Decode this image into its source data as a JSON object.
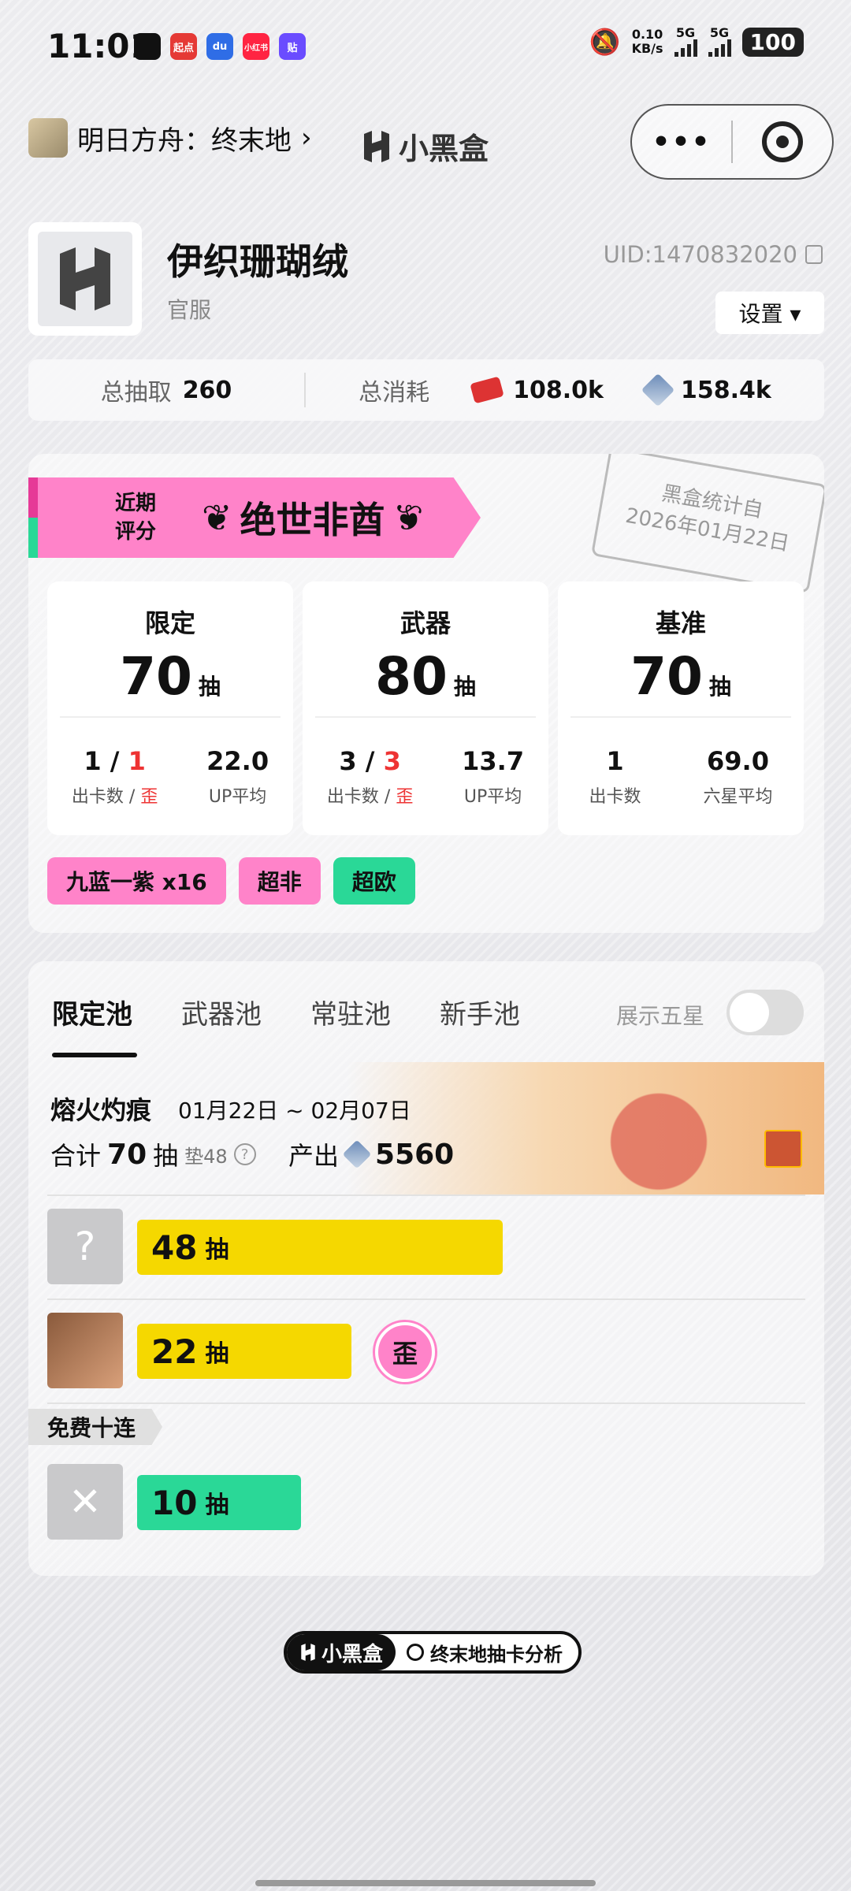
{
  "status": {
    "time": "11:01",
    "apps": [
      {
        "text": "",
        "color": "#111111"
      },
      {
        "text": "起点",
        "color": "#e53935"
      },
      {
        "text": "du",
        "color": "#2f6de6"
      },
      {
        "text": "小红书",
        "color": "#ff2442"
      },
      {
        "text": "贴",
        "color": "#6a4cff"
      }
    ],
    "net_speed": "0.10",
    "net_unit": "KB/s",
    "net_tag1": "5G",
    "net_tag2": "5G",
    "battery": "100"
  },
  "nav": {
    "game_title": "明日方舟：终末地",
    "chevron": "›",
    "brand": "小黑盒",
    "menu_dots": "•••"
  },
  "profile": {
    "name": "伊织珊瑚绒",
    "server": "官服",
    "uid": "UID:1470832020",
    "settings_label": "设置 ▾"
  },
  "totals": {
    "pulls_label": "总抽取",
    "pulls_value": "260",
    "spend_label": "总消耗",
    "ticket_value": "108.0k",
    "orundum_value": "158.4k"
  },
  "summary": {
    "rating_label": "近期\n评分",
    "rating_value": "绝世非酋",
    "laurel_left": "❦",
    "laurel_right": "❦",
    "stamp_line1": "黑盒统计自",
    "stamp_line2": "2026年01月22日",
    "pull_unit": "抽",
    "boxes": [
      {
        "title": "限定",
        "count": "70",
        "a": "1",
        "b": "1",
        "avg": "22.0",
        "a_label": "出卡数",
        "b_label": "歪",
        "avg_label": "UP平均"
      },
      {
        "title": "武器",
        "count": "80",
        "a": "3",
        "b": "3",
        "avg": "13.7",
        "a_label": "出卡数",
        "b_label": "歪",
        "avg_label": "UP平均"
      },
      {
        "title": "基准",
        "count": "70",
        "a": "1",
        "avg": "69.0",
        "a_label": "出卡数",
        "avg_label": "六星平均"
      }
    ],
    "tags": [
      {
        "label": "九蓝一紫 x16",
        "color": "#ff83c9"
      },
      {
        "label": "超非",
        "color": "#ff83c9"
      },
      {
        "label": "超欧",
        "color": "#2ad897"
      }
    ]
  },
  "pool": {
    "tabs": [
      "限定池",
      "武器池",
      "常驻池",
      "新手池"
    ],
    "toggle_label": "展示五星",
    "name": "熔火灼痕",
    "date": "01月22日 ~ 02月07日",
    "total_label": "合计",
    "total_value": "70",
    "total_unit": "抽",
    "pity": "垫48",
    "help": "?",
    "output_label": "产出",
    "output_value": "5560",
    "rows": [
      {
        "count": "48",
        "unit": "抽",
        "avatar": "?",
        "fraction": 0.58,
        "color": "#f5d800",
        "avatar_bg": "#c9c9cb"
      },
      {
        "count": "22",
        "unit": "抽",
        "avatar": "",
        "fraction": 0.34,
        "color": "#f5d800",
        "avatar_bg": "#8a5a3c",
        "badge": "歪"
      }
    ],
    "free_label": "免费十连",
    "free_row": {
      "count": "10",
      "unit": "抽",
      "avatar": "✕",
      "fraction": 0.26,
      "color": "#2ad897",
      "avatar_bg": "#c9c9cb"
    }
  },
  "footer": {
    "brand": "小黑盒",
    "search_text": "终末地抽卡分析"
  }
}
